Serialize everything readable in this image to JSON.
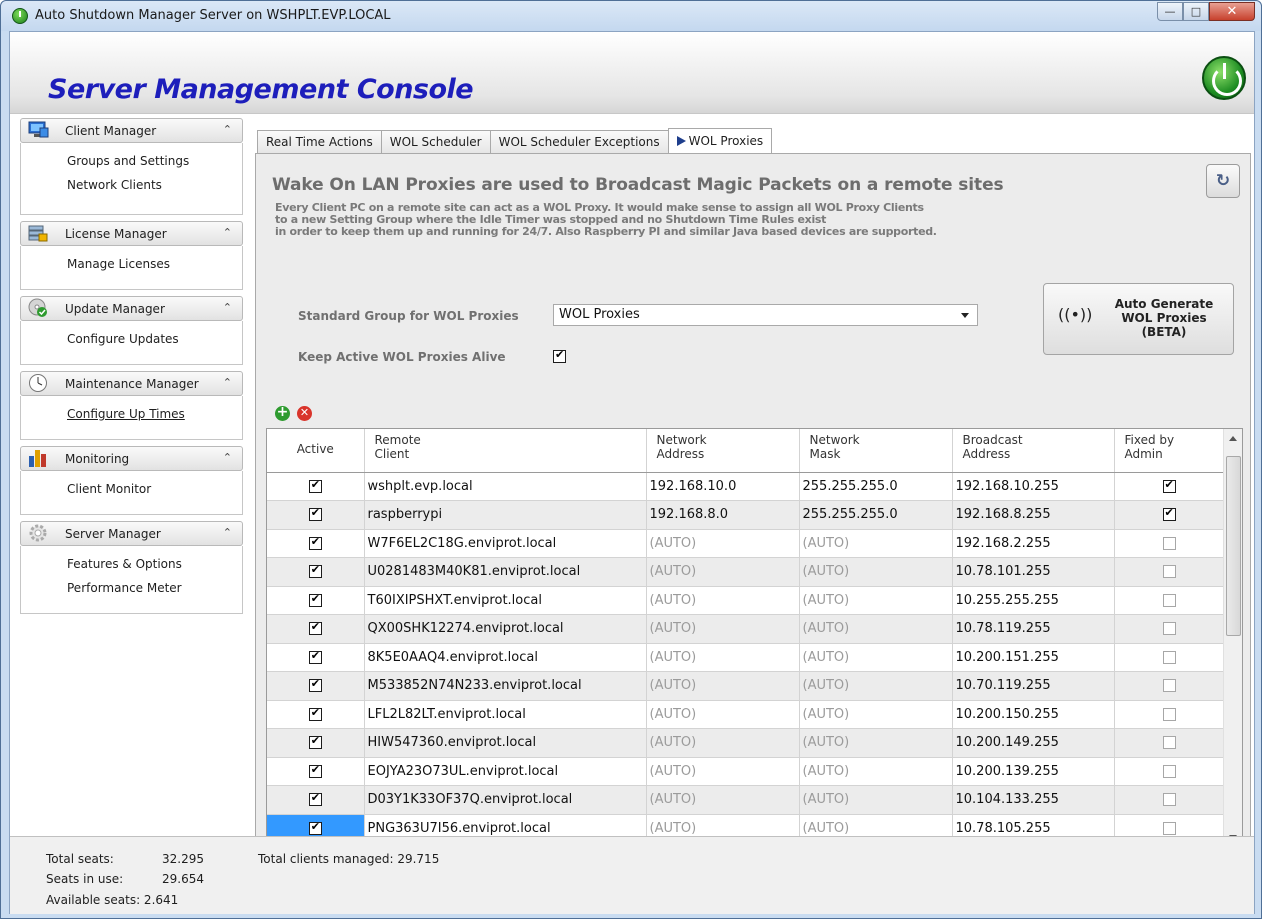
{
  "window": {
    "title": "Auto Shutdown Manager Server on WSHPLT.EVP.LOCAL",
    "controls": [
      "minimize",
      "maximize",
      "close"
    ]
  },
  "header": {
    "title": "Server Management Console"
  },
  "sidebar": {
    "sections": [
      {
        "label": "Client Manager",
        "icon": "client-manager-icon",
        "items": [
          "Groups and Settings",
          "Network Clients"
        ]
      },
      {
        "label": "License Manager",
        "icon": "license-manager-icon",
        "items": [
          "Manage Licenses"
        ]
      },
      {
        "label": "Update  Manager",
        "icon": "update-manager-icon",
        "items": [
          "Configure Updates"
        ]
      },
      {
        "label": "Maintenance Manager",
        "icon": "clock-icon",
        "items": [
          "Configure Up Times"
        ]
      },
      {
        "label": "Monitoring",
        "icon": "bar-chart-icon",
        "items": [
          "Client Monitor"
        ]
      },
      {
        "label": "Server Manager",
        "icon": "gear-icon",
        "items": [
          "Features & Options",
          "Performance Meter"
        ]
      }
    ]
  },
  "tabs": [
    {
      "label": "Real Time Actions",
      "active": false
    },
    {
      "label": "WOL Scheduler",
      "active": false
    },
    {
      "label": "WOL Scheduler Exceptions",
      "active": false
    },
    {
      "label": "WOL Proxies",
      "active": true
    }
  ],
  "panel": {
    "title": "Wake On LAN Proxies are used to Broadcast Magic Packets on a remote sites",
    "description": [
      "Every Client PC on a remote site can act as a WOL Proxy. It would make sense to assign all WOL Proxy Clients",
      "to a new Setting Group where the Idle Timer was stopped and no Shutdown Time Rules exist",
      "in order to keep them up and running for 24/7. Also Raspberry PI and similar Java based devices are supported."
    ],
    "standard_group_label": "Standard Group for WOL Proxies",
    "standard_group_value": "WOL Proxies",
    "keep_alive_label": "Keep Active WOL Proxies Alive",
    "keep_alive_checked": true,
    "generate_button": {
      "line1": "Auto Generate",
      "line2": "WOL Proxies",
      "line3": "(BETA)"
    }
  },
  "grid": {
    "columns": [
      {
        "line1": "Active",
        "line2": ""
      },
      {
        "line1": "Remote",
        "line2": "Client"
      },
      {
        "line1": "Network",
        "line2": "Address"
      },
      {
        "line1": "Network",
        "line2": "Mask"
      },
      {
        "line1": "Broadcast",
        "line2": "Address"
      },
      {
        "line1": "Fixed by",
        "line2": "Admin"
      }
    ],
    "rows": [
      {
        "active": true,
        "client": "wshplt.evp.local",
        "network": "192.168.10.0",
        "mask": "255.255.255.0",
        "broadcast": "192.168.10.255",
        "fixed": true
      },
      {
        "active": true,
        "client": "raspberrypi",
        "network": "192.168.8.0",
        "mask": "255.255.255.0",
        "broadcast": "192.168.8.255",
        "fixed": true
      },
      {
        "active": true,
        "client": "W7F6EL2C18G.enviprot.local",
        "network": "(AUTO)",
        "mask": "(AUTO)",
        "broadcast": "192.168.2.255",
        "fixed": false
      },
      {
        "active": true,
        "client": "U0281483M40K81.enviprot.local",
        "network": "(AUTO)",
        "mask": "(AUTO)",
        "broadcast": "10.78.101.255",
        "fixed": false
      },
      {
        "active": true,
        "client": "T60IXIPSHXT.enviprot.local",
        "network": "(AUTO)",
        "mask": "(AUTO)",
        "broadcast": "10.255.255.255",
        "fixed": false
      },
      {
        "active": true,
        "client": "QX00SHK12274.enviprot.local",
        "network": "(AUTO)",
        "mask": "(AUTO)",
        "broadcast": "10.78.119.255",
        "fixed": false
      },
      {
        "active": true,
        "client": "8K5E0AAQ4.enviprot.local",
        "network": "(AUTO)",
        "mask": "(AUTO)",
        "broadcast": "10.200.151.255",
        "fixed": false
      },
      {
        "active": true,
        "client": "M533852N74N233.enviprot.local",
        "network": "(AUTO)",
        "mask": "(AUTO)",
        "broadcast": "10.70.119.255",
        "fixed": false
      },
      {
        "active": true,
        "client": "LFL2L82LT.enviprot.local",
        "network": "(AUTO)",
        "mask": "(AUTO)",
        "broadcast": "10.200.150.255",
        "fixed": false
      },
      {
        "active": true,
        "client": "HIW547360.enviprot.local",
        "network": "(AUTO)",
        "mask": "(AUTO)",
        "broadcast": "10.200.149.255",
        "fixed": false
      },
      {
        "active": true,
        "client": "EOJYA23O73UL.enviprot.local",
        "network": "(AUTO)",
        "mask": "(AUTO)",
        "broadcast": "10.200.139.255",
        "fixed": false
      },
      {
        "active": true,
        "client": "D03Y1K33OF37Q.enviprot.local",
        "network": "(AUTO)",
        "mask": "(AUTO)",
        "broadcast": "10.104.133.255",
        "fixed": false
      },
      {
        "active": true,
        "client": "PNG363U7I56.enviprot.local",
        "network": "(AUTO)",
        "mask": "(AUTO)",
        "broadcast": "10.78.105.255",
        "fixed": false,
        "selected": true
      }
    ]
  },
  "footer": {
    "total_seats_label": "Total seats:",
    "total_seats_value": "32.295",
    "seats_in_use_label": "Seats in use:",
    "seats_in_use_value": "29.654",
    "available_seats": "Available seats: 2.641",
    "total_clients": "Total clients managed: 29.715"
  },
  "colors": {
    "header_title": "#1d1ebb",
    "selection": "#3399ff",
    "alt_row": "#ececec",
    "auto_text": "#9b9b9b"
  }
}
